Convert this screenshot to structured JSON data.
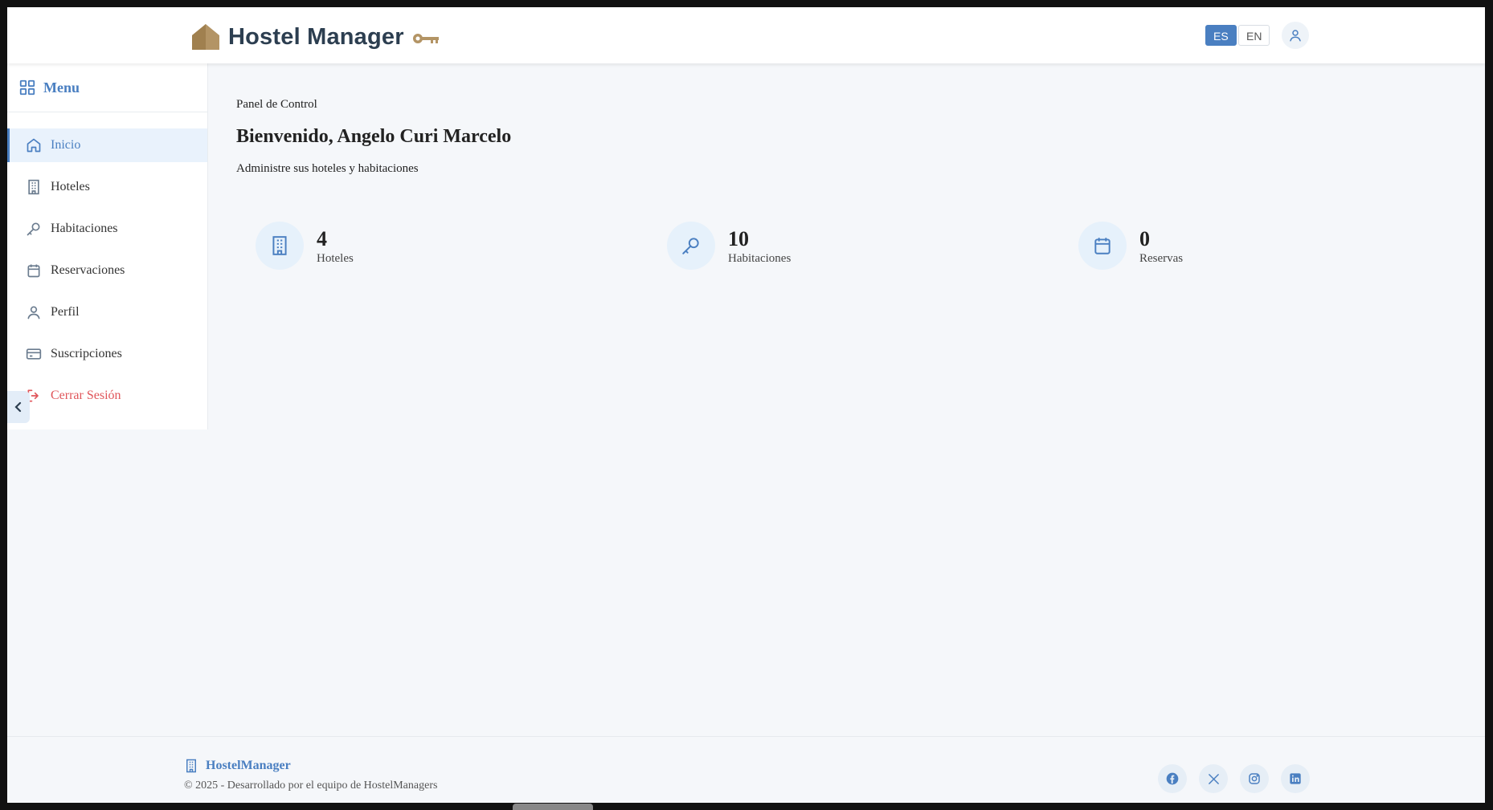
{
  "header": {
    "title": "Hostel Manager",
    "languages": {
      "es": "ES",
      "en": "EN",
      "selected": "ES"
    }
  },
  "sidebar": {
    "menu_title": "Menu",
    "items": [
      {
        "label": "Inicio",
        "icon": "home-icon",
        "active": true
      },
      {
        "label": "Hoteles",
        "icon": "building-icon"
      },
      {
        "label": "Habitaciones",
        "icon": "key-icon"
      },
      {
        "label": "Reservaciones",
        "icon": "calendar-icon"
      },
      {
        "label": "Perfil",
        "icon": "user-icon"
      },
      {
        "label": "Suscripciones",
        "icon": "credit-card-icon"
      },
      {
        "label": "Cerrar Sesión",
        "icon": "logout-icon"
      }
    ]
  },
  "main": {
    "breadcrumb": "Panel de Control",
    "welcome": "Bienvenido, Angelo Curi Marcelo",
    "subtitle": "Administre sus hoteles y habitaciones",
    "stats": [
      {
        "value": "4",
        "label": "Hoteles",
        "icon": "building-icon"
      },
      {
        "value": "10",
        "label": "Habitaciones",
        "icon": "key-icon"
      },
      {
        "value": "0",
        "label": "Reservas",
        "icon": "calendar-icon"
      }
    ]
  },
  "footer": {
    "brand": "HostelManager",
    "copyright": "© 2025 - Desarrollado por el equipo de HostelManagers",
    "social": [
      "facebook-icon",
      "x-icon",
      "instagram-icon",
      "linkedin-icon"
    ]
  },
  "colors": {
    "accent": "#4a7fc1",
    "danger": "#e0555a",
    "title": "#2c3e50",
    "logo": "#a8895e"
  }
}
